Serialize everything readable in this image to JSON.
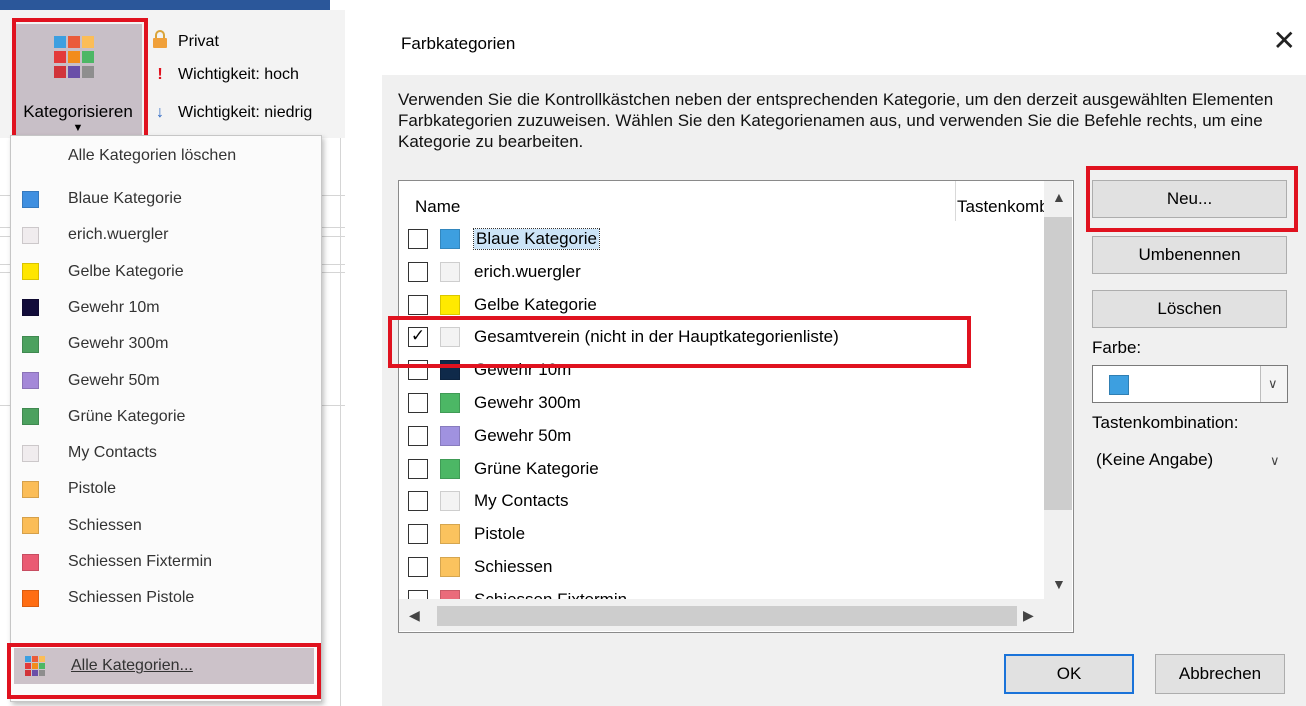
{
  "ribbon": {
    "categorize_label": "Kategorisieren",
    "private_label": "Privat",
    "importance_high_label": "Wichtigkeit: hoch",
    "importance_low_label": "Wichtigkeit: niedrig"
  },
  "menu": {
    "clear_all": "Alle Kategorien löschen",
    "items": [
      {
        "label": "Blaue Kategorie",
        "color": "#3f8fe0"
      },
      {
        "label": "erich.wuergler",
        "color": "#f0ecee"
      },
      {
        "label": "Gelbe Kategorie",
        "color": "#ffe600"
      },
      {
        "label": "Gewehr 10m",
        "color": "#120c3a"
      },
      {
        "label": "Gewehr 300m",
        "color": "#4ca15f"
      },
      {
        "label": "Gewehr 50m",
        "color": "#a488d8"
      },
      {
        "label": "Grüne Kategorie",
        "color": "#4ca15f"
      },
      {
        "label": "My Contacts",
        "color": "#f0ecee"
      },
      {
        "label": "Pistole",
        "color": "#fbbd57"
      },
      {
        "label": "Schiessen",
        "color": "#fbbd57"
      },
      {
        "label": "Schiessen Fixtermin",
        "color": "#ea5b73"
      },
      {
        "label": "Schiessen Pistole",
        "color": "#ff6d13"
      }
    ],
    "all_categories": "Alle Kategorien..."
  },
  "dialog": {
    "title": "Farbkategorien",
    "instructions": "Verwenden Sie die Kontrollkästchen neben der entsprechenden Kategorie, um den derzeit ausgewählten Elementen Farbkategorien zuzuweisen. Wählen Sie den Kategorienamen aus, und verwenden Sie die Befehle rechts, um eine Kategorie zu bearbeiten.",
    "col_name": "Name",
    "col_shortcut": "Tastenkombination",
    "rows": [
      {
        "label": "Blaue Kategorie",
        "color": "#3d9fe0",
        "checked": false,
        "selected": true
      },
      {
        "label": "erich.wuergler",
        "color": "#f3f3f3",
        "checked": false
      },
      {
        "label": "Gelbe Kategorie",
        "color": "#ffea00",
        "checked": false
      },
      {
        "label": "Gesamtverein (nicht in der Hauptkategorienliste)",
        "color": "#f3f3f3",
        "checked": true
      },
      {
        "label": "Gewehr 10m",
        "color": "#0f2a4a",
        "checked": false
      },
      {
        "label": "Gewehr 300m",
        "color": "#4cb765",
        "checked": false
      },
      {
        "label": "Gewehr 50m",
        "color": "#a092e0",
        "checked": false
      },
      {
        "label": "Grüne Kategorie",
        "color": "#4cb765",
        "checked": false
      },
      {
        "label": "My Contacts",
        "color": "#f3f3f3",
        "checked": false
      },
      {
        "label": "Pistole",
        "color": "#fbc35e",
        "checked": false
      },
      {
        "label": "Schiessen",
        "color": "#fbc35e",
        "checked": false
      },
      {
        "label": "Schiessen Fixtermin",
        "color": "#ea6b7a",
        "checked": false
      }
    ],
    "btn_new": "Neu...",
    "btn_rename": "Umbenennen",
    "btn_delete": "Löschen",
    "color_label": "Farbe:",
    "color_value": "#3d9fe0",
    "shortcut_label": "Tastenkombination:",
    "shortcut_value": "(Keine Angabe)",
    "btn_ok": "OK",
    "btn_cancel": "Abbrechen"
  }
}
